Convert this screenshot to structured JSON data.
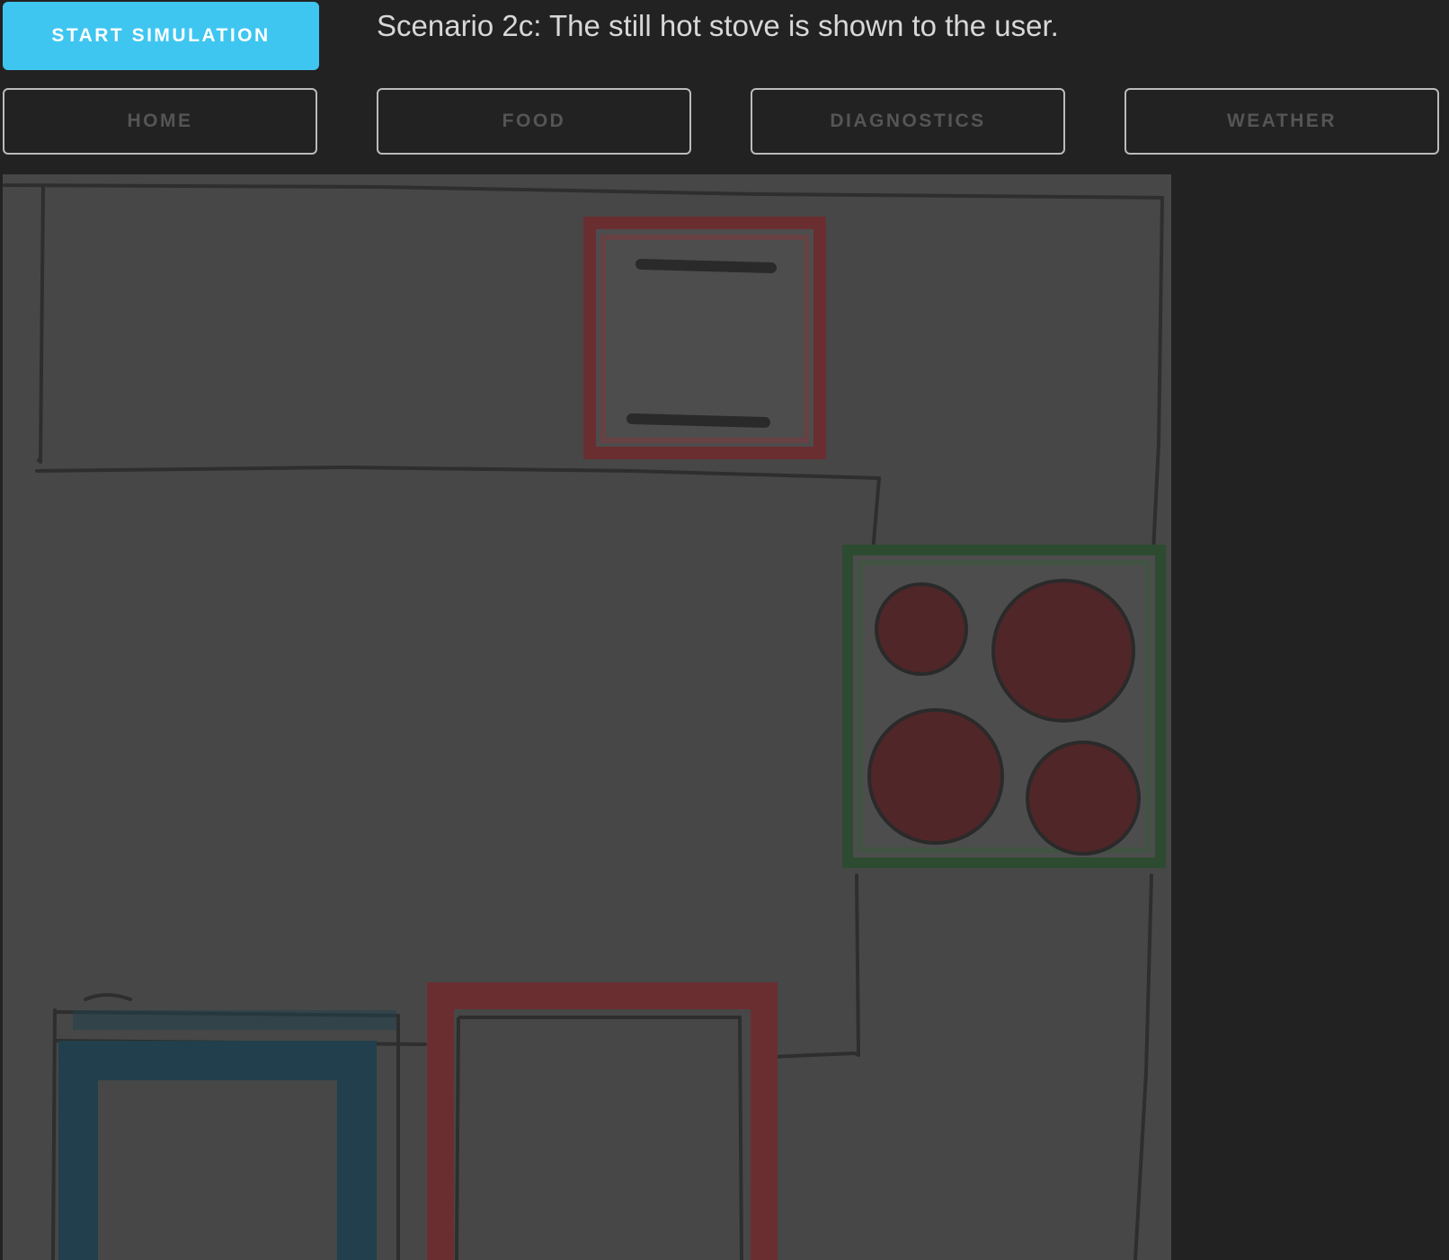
{
  "toolbar": {
    "start_label": "START SIMULATION",
    "scenario_text": "Scenario 2c: The still hot stove is shown to the user."
  },
  "nav": {
    "tabs": [
      {
        "label": "HOME"
      },
      {
        "label": "FOOD"
      },
      {
        "label": "DIAGNOSTICS"
      },
      {
        "label": "WEATHER"
      }
    ]
  },
  "floorplan": {
    "elements": [
      {
        "name": "fridge",
        "highlight": "red"
      },
      {
        "name": "stove",
        "highlight": "green",
        "burners": 4,
        "burner_state": "hot"
      },
      {
        "name": "sink",
        "highlight": "blue"
      },
      {
        "name": "oven",
        "highlight": "red"
      }
    ]
  },
  "colors": {
    "accent": "#3ec6f0",
    "background": "#222222",
    "canvas": "#474747",
    "highlight_red": "#6a2e31",
    "highlight_green": "#2d4b30",
    "highlight_blue": "#213f4c",
    "burner": "#512628"
  }
}
